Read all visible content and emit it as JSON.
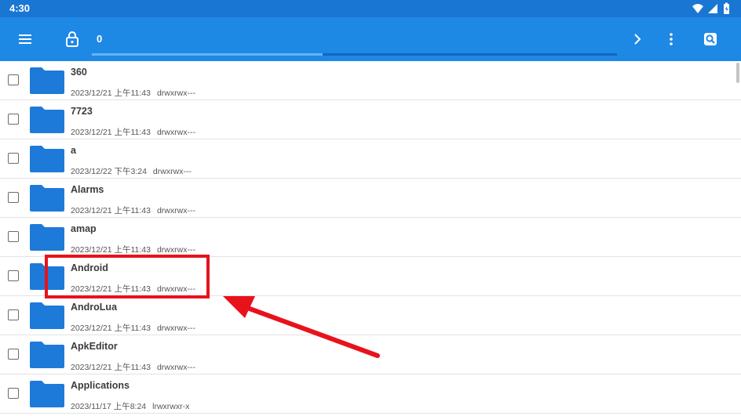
{
  "status_bar": {
    "time": "4:30",
    "icons": [
      "wifi-icon",
      "signal-icon",
      "battery-icon"
    ]
  },
  "toolbar": {
    "selected_count": "0",
    "icons": [
      "menu-icon",
      "lock-icon",
      "chevron-right-icon",
      "more-vert-icon",
      "search-icon"
    ],
    "scan_progress": 0.44
  },
  "colors": {
    "status_bar": "#1976d2",
    "toolbar": "#1e88e5",
    "folder": "#1e7ad8",
    "annotation": "#e8121b"
  },
  "files": [
    {
      "name": "360",
      "date": "2023/12/21 上午11:43",
      "perm": "drwxrwx---"
    },
    {
      "name": "7723",
      "date": "2023/12/21 上午11:43",
      "perm": "drwxrwx---"
    },
    {
      "name": "a",
      "date": "2023/12/22 下午3:24",
      "perm": "drwxrwx---"
    },
    {
      "name": "Alarms",
      "date": "2023/12/21 上午11:43",
      "perm": "drwxrwx---"
    },
    {
      "name": "amap",
      "date": "2023/12/21 上午11:43",
      "perm": "drwxrwx---"
    },
    {
      "name": "Android",
      "date": "2023/12/21 上午11:43",
      "perm": "drwxrwx---"
    },
    {
      "name": "AndroLua",
      "date": "2023/12/21 上午11:43",
      "perm": "drwxrwx---"
    },
    {
      "name": "ApkEditor",
      "date": "2023/12/21 上午11:43",
      "perm": "drwxrwx---"
    },
    {
      "name": "Applications",
      "date": "2023/11/17 上午8:24",
      "perm": "lrwxrwxr-x"
    }
  ]
}
